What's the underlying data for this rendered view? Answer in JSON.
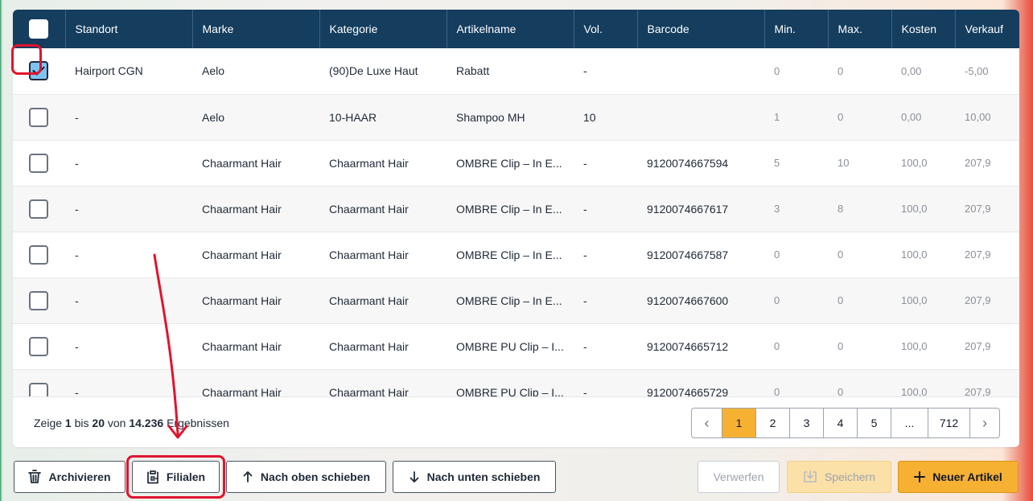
{
  "table": {
    "columns": [
      "Standort",
      "Marke",
      "Kategorie",
      "Artikelname",
      "Vol.",
      "Barcode",
      "Min.",
      "Max.",
      "Kosten",
      "Verkauf"
    ],
    "rows": [
      {
        "checked": true,
        "cells": [
          "Hairport CGN",
          "Aelo",
          "(90)De Luxe Haut",
          "Rabatt",
          "-",
          "",
          "0",
          "0",
          "0,00",
          "-5,00"
        ]
      },
      {
        "checked": false,
        "cells": [
          "-",
          "Aelo",
          "10-HAAR",
          "Shampoo MH",
          "10",
          "",
          "1",
          "0",
          "0,00",
          "10,00"
        ]
      },
      {
        "checked": false,
        "cells": [
          "-",
          "Chaarmant Hair",
          "Chaarmant Hair",
          "OMBRE Clip – In E...",
          "-",
          "9120074667594",
          "5",
          "10",
          "100,0",
          "207,9"
        ]
      },
      {
        "checked": false,
        "cells": [
          "-",
          "Chaarmant Hair",
          "Chaarmant Hair",
          "OMBRE Clip – In E...",
          "-",
          "9120074667617",
          "3",
          "8",
          "100,0",
          "207,9"
        ]
      },
      {
        "checked": false,
        "cells": [
          "-",
          "Chaarmant Hair",
          "Chaarmant Hair",
          "OMBRE Clip – In E...",
          "-",
          "9120074667587",
          "0",
          "0",
          "100,0",
          "207,9"
        ]
      },
      {
        "checked": false,
        "cells": [
          "-",
          "Chaarmant Hair",
          "Chaarmant Hair",
          "OMBRE Clip – In E...",
          "-",
          "9120074667600",
          "0",
          "0",
          "100,0",
          "207,9"
        ]
      },
      {
        "checked": false,
        "cells": [
          "-",
          "Chaarmant Hair",
          "Chaarmant Hair",
          "OMBRE PU Clip – I...",
          "-",
          "9120074665712",
          "0",
          "0",
          "100,0",
          "207,9"
        ]
      },
      {
        "checked": false,
        "cells": [
          "-",
          "Chaarmant Hair",
          "Chaarmant Hair",
          "OMBRE PU Clip – I...",
          "-",
          "9120074665729",
          "0",
          "0",
          "100,0",
          "207,9"
        ]
      }
    ]
  },
  "summary": {
    "prefix": "Zeige",
    "from": "1",
    "middle1": "bis",
    "to": "20",
    "middle2": "von",
    "total": "14.236",
    "suffix": "Ergebnissen"
  },
  "pagination": {
    "prev_icon": "chevron-left-icon",
    "next_icon": "chevron-right-icon",
    "pages": [
      "1",
      "2",
      "3",
      "4",
      "5",
      "...",
      "712"
    ],
    "active": "1"
  },
  "actions": {
    "archive_label": "Archivieren",
    "branches_label": "Filialen",
    "move_up_label": "Nach oben schieben",
    "move_down_label": "Nach unten schieben",
    "discard_label": "Verwerfen",
    "save_label": "Speichern",
    "new_item_label": "Neuer Artikel"
  },
  "colors": {
    "header_bg": "#143d5e",
    "accent": "#f6b032",
    "annotation": "#e0142e"
  }
}
